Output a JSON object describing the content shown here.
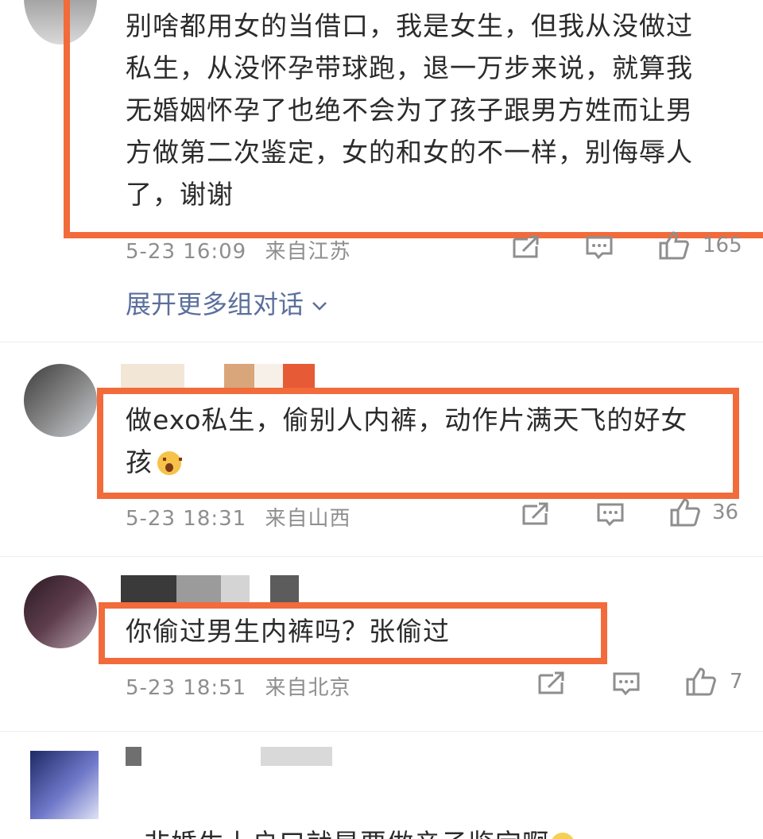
{
  "comments": [
    {
      "text": "别啥都用女的当借口，我是女生，但我从没做过\n私生，从没怀孕带球跑，退一万步来说，就算我\n无婚姻怀孕了也绝不会为了孩子跟男方姓而让男\n方做第二次鉴定，女的和女的不一样，别侮辱人\n了，谢谢",
      "time": "5-23 16:09",
      "location": "来自江苏",
      "likes": "165"
    },
    {
      "text": "做exo私生，偷别人内裤，动作片满天飞的好女\n孩",
      "time": "5-23 18:31",
      "location": "来自山西",
      "likes": "36"
    },
    {
      "text": "你偷过男生内裤吗？张偷过",
      "time": "5-23 18:51",
      "location": "来自北京",
      "likes": "7"
    },
    {
      "text": "非婚生上户口就是要做亲子鉴定啊"
    }
  ],
  "expand_label": "展开更多组对话",
  "icons": {
    "share": "share-icon",
    "comment": "comment-icon",
    "like": "thumbs-up-icon",
    "expand": "chevron-down-icon"
  },
  "colors": {
    "highlight": "#f26b3a",
    "meta": "#8e8e8e",
    "link": "#5b6f9c"
  }
}
